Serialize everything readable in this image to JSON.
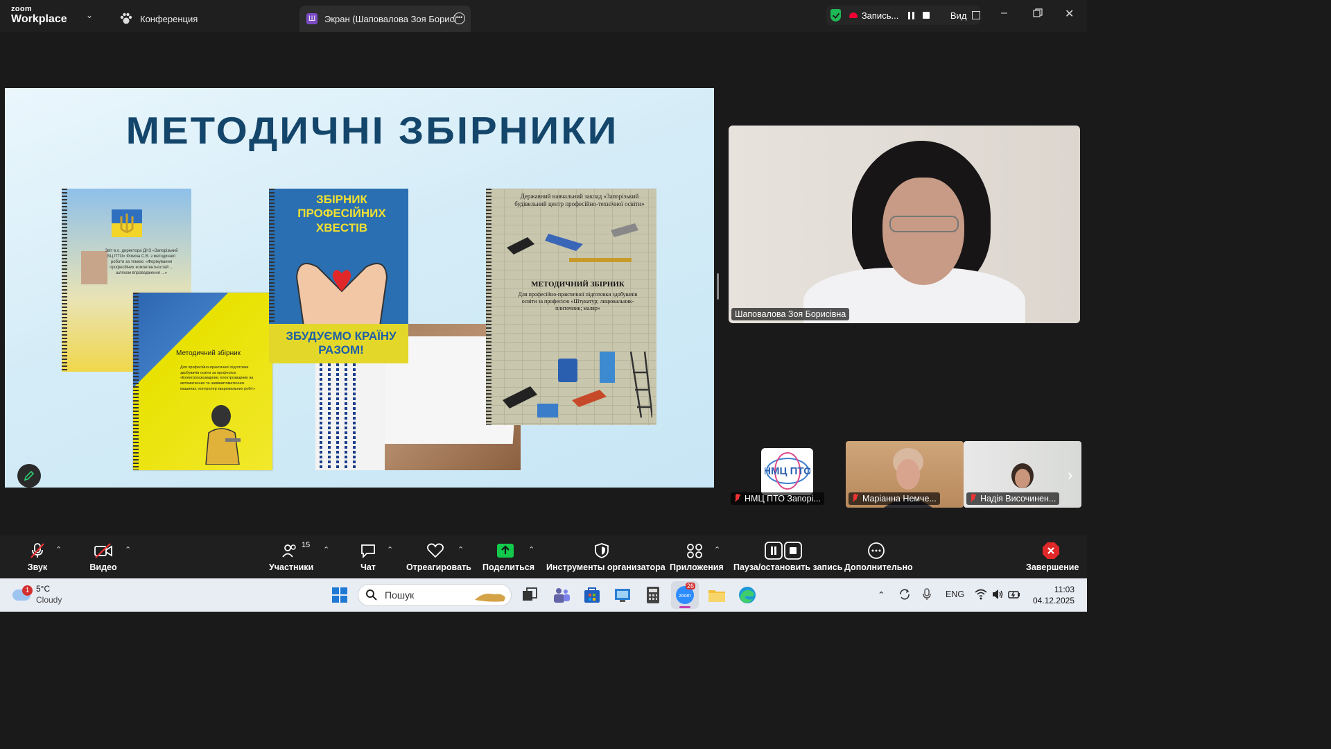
{
  "titlebar": {
    "logo_top": "zoom",
    "logo_bottom": "Workplace",
    "tab_conference": "Конференция",
    "tab_screen_badge": "Ш",
    "tab_screen": "Экран (Шаповалова Зоя Борисі",
    "recording_label": "Запись...",
    "view_label": "Вид"
  },
  "slide": {
    "title": "МЕТОДИЧНІ ЗБІРНИКИ",
    "book1_text": "Звіт в.о. директора ДНЗ «Запорізький БЦ ПТО» Фоміча С.В. з методичної роботи за темою: «Формування професійних компетентностей ... шляхом впровадження ...»",
    "book2_title": "Методичний збірник",
    "book2_text": "Для професійно-практичної підготовки здобувачів освіти за професією «Електрогазозварник; електрозварник на автоматичних та напівавтоматичних машинах; контролер зварювальних робіт»",
    "book3_top": "ЗБІРНИК ПРОФЕСІЙНИХ ХВЕСТІВ",
    "book3_bottom": "ЗБУДУЄМО КРАЇНУ РАЗОМ!",
    "book5_head": "Державний навчальний заклад «Запорізький будівельний центр професійно-технічної освіти»",
    "book5_title": "МЕТОДИЧНИЙ ЗБІРНИК",
    "book5_sub": "Для професійно-практичної підготовки здобувачів освіти за професією «Штукатур; лицювальник-плиточник; маляр»"
  },
  "speaker": {
    "name": "Шаповалова Зоя Борисівна"
  },
  "tiles": [
    {
      "name": "НМЦ ПТО Запорі...",
      "logo": "НМЦ ПТО"
    },
    {
      "name": "Маріанна Немче..."
    },
    {
      "name": "Надія Височинен..."
    }
  ],
  "toolbar": {
    "audio": "Звук",
    "video": "Видео",
    "participants": "Участники",
    "participants_count": "15",
    "chat": "Чат",
    "react": "Отреагировать",
    "share": "Поделиться",
    "host_tools": "Инструменты организатора",
    "apps": "Приложения",
    "pause_record": "Пауза/остановить запись",
    "more": "Дополнительно",
    "end": "Завершение"
  },
  "taskbar": {
    "weather_badge": "1",
    "temperature": "5°C",
    "condition": "Cloudy",
    "search_placeholder": "Пошук",
    "zoom_badge": "26",
    "lang": "ENG",
    "time": "11:03",
    "date": "04.12.2025"
  },
  "colors": {
    "accent_green": "#1db954",
    "share_green": "#12c94b",
    "end_red": "#e02828",
    "slide_title": "#14466b"
  }
}
